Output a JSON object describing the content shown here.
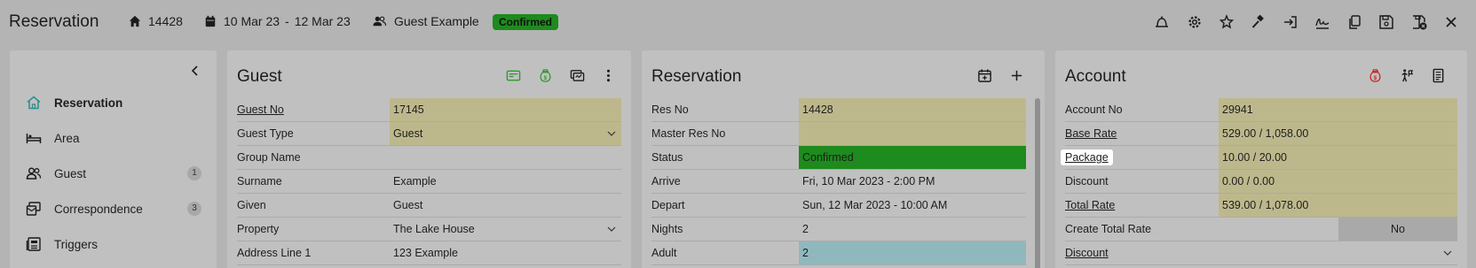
{
  "header": {
    "title": "Reservation",
    "res_no": "14428",
    "date_from": "10 Mar 23",
    "date_sep": "-",
    "date_to": "12 Mar 23",
    "guest_name": "Guest Example",
    "status_badge": "Confirmed",
    "tools": [
      "bell-icon",
      "settings-icon",
      "magic-icon",
      "gavel-icon",
      "check-in-icon",
      "signature-icon",
      "copy-icon",
      "save-icon",
      "save-close-icon",
      "close-icon"
    ]
  },
  "sidebar": {
    "items": [
      {
        "label": "Reservation",
        "icon": "home-icon",
        "count": ""
      },
      {
        "label": "Area",
        "icon": "bed-icon",
        "count": ""
      },
      {
        "label": "Guest",
        "icon": "guest-icon",
        "count": "1"
      },
      {
        "label": "Correspondence",
        "icon": "correspondence-icon",
        "count": "3"
      },
      {
        "label": "Triggers",
        "icon": "triggers-icon",
        "count": ""
      }
    ]
  },
  "guest": {
    "title": "Guest",
    "rows": [
      {
        "label": "Guest No",
        "value": "17145"
      },
      {
        "label": "Guest Type",
        "value": "Guest"
      },
      {
        "label": "Group Name",
        "value": ""
      },
      {
        "label": "Surname",
        "value": "Example"
      },
      {
        "label": "Given",
        "value": "Guest"
      },
      {
        "label": "Property",
        "value": "The Lake House"
      },
      {
        "label": "Address Line 1",
        "value": "123 Example"
      }
    ]
  },
  "reservation": {
    "title": "Reservation",
    "rows": [
      {
        "label": "Res No",
        "value": "14428"
      },
      {
        "label": "Master Res No",
        "value": ""
      },
      {
        "label": "Status",
        "value": "Confirmed"
      },
      {
        "label": "Arrive",
        "value": "Fri, 10 Mar 2023 - 2:00 PM"
      },
      {
        "label": "Depart",
        "value": "Sun, 12 Mar 2023 - 10:00 AM"
      },
      {
        "label": "Nights",
        "value": "2"
      },
      {
        "label": "Adult",
        "value": "2"
      }
    ]
  },
  "account": {
    "title": "Account",
    "rows": [
      {
        "label": "Account No",
        "value": "29941"
      },
      {
        "label": "Base Rate",
        "value": "529.00 / 1,058.00"
      },
      {
        "label": "Package",
        "value": "10.00 / 20.00"
      },
      {
        "label": "Discount",
        "value": "0.00 / 0.00"
      },
      {
        "label": "Total Rate",
        "value": "539.00 / 1,078.00"
      },
      {
        "label": "Create Total Rate",
        "value": "No"
      },
      {
        "label": "Discount",
        "value": ""
      }
    ]
  },
  "colors": {
    "background": "#b4b4b4",
    "panel": "#c0c0c0",
    "yellow_field": "#bdb88c",
    "confirmed_green": "#1d8b1d",
    "teal_field": "#8fb8bd",
    "red_icon": "#c62828"
  }
}
